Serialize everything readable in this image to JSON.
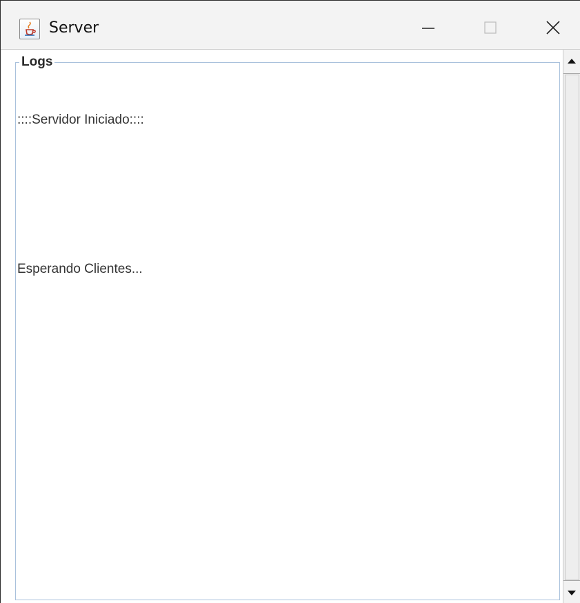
{
  "window": {
    "title": "Server",
    "app_icon": "java-cup-icon",
    "controls": {
      "minimize_icon": "minimize-icon",
      "maximize_icon": "maximize-icon",
      "close_icon": "close-icon"
    }
  },
  "logs_panel": {
    "title": "Logs",
    "lines": [
      "::::Servidor Iniciado::::",
      "",
      "",
      "Esperando Clientes..."
    ]
  },
  "colors": {
    "titlebar_bg": "#f3f3f3",
    "group_border": "#a9c1dc",
    "text": "#333333"
  }
}
